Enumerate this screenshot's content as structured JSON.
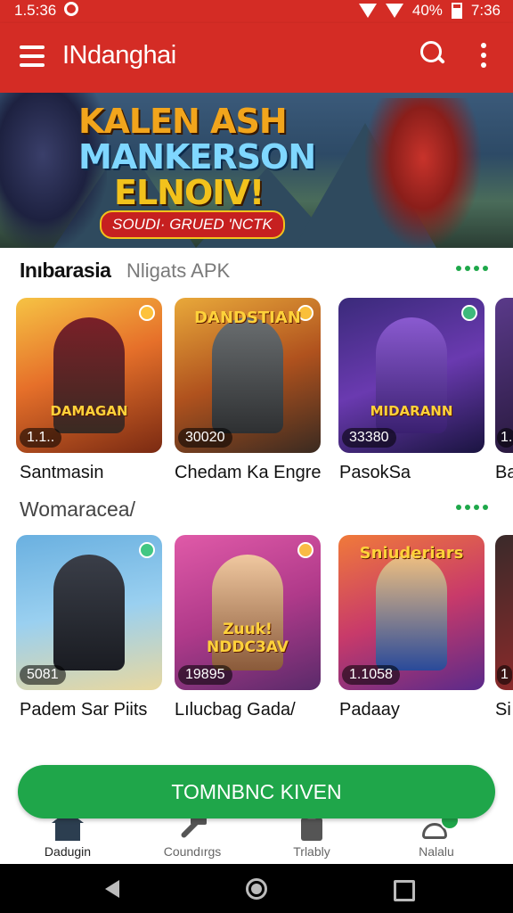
{
  "status": {
    "time": "1.5:36",
    "battery": "40%",
    "clock": "7:36"
  },
  "appbar": {
    "title": "INdanghai"
  },
  "banner": {
    "line1": "KALEN ASH",
    "line2": "MANKERSON",
    "line3": "ELNOIV!",
    "badge": "SOUDI· GRUED 'NCTK"
  },
  "section1": {
    "title": "Inıbarasia",
    "subtitle": "Nligats APK",
    "cards": [
      {
        "count": "1.1..",
        "label": "Santmasin",
        "logo": "DAMAGAN"
      },
      {
        "count": "30020",
        "label": "Chedam Ka Engre",
        "logo": "DANDSTIAN"
      },
      {
        "count": "33380",
        "label": "PasokSa",
        "logo": "MIDARANN"
      },
      {
        "count": "1.",
        "label": "Ba",
        "logo": ""
      }
    ]
  },
  "section2": {
    "title": "Womaracea/",
    "cards": [
      {
        "count": "5081",
        "label": "Padem Sar Piits",
        "logo": ""
      },
      {
        "count": "19895",
        "label": "Lılucbag Gada/",
        "logo": "Zuuk! NDDC3AV"
      },
      {
        "count": "1.1058",
        "label": "Padaay",
        "logo": "Sniuderiars"
      },
      {
        "count": "1",
        "label": "Si",
        "logo": ""
      }
    ]
  },
  "install_button": {
    "label": "TOMNBNC KIVEN"
  },
  "bottom_nav": [
    {
      "label": "Dadugin",
      "icon": "home-icon"
    },
    {
      "label": "Coundırgs",
      "icon": "tools-icon"
    },
    {
      "label": "Trlably",
      "icon": "clipboard-icon"
    },
    {
      "label": "Nalalu",
      "icon": "notification-icon"
    }
  ],
  "colors": {
    "primary": "#d42c25",
    "accent": "#1fa64a"
  }
}
